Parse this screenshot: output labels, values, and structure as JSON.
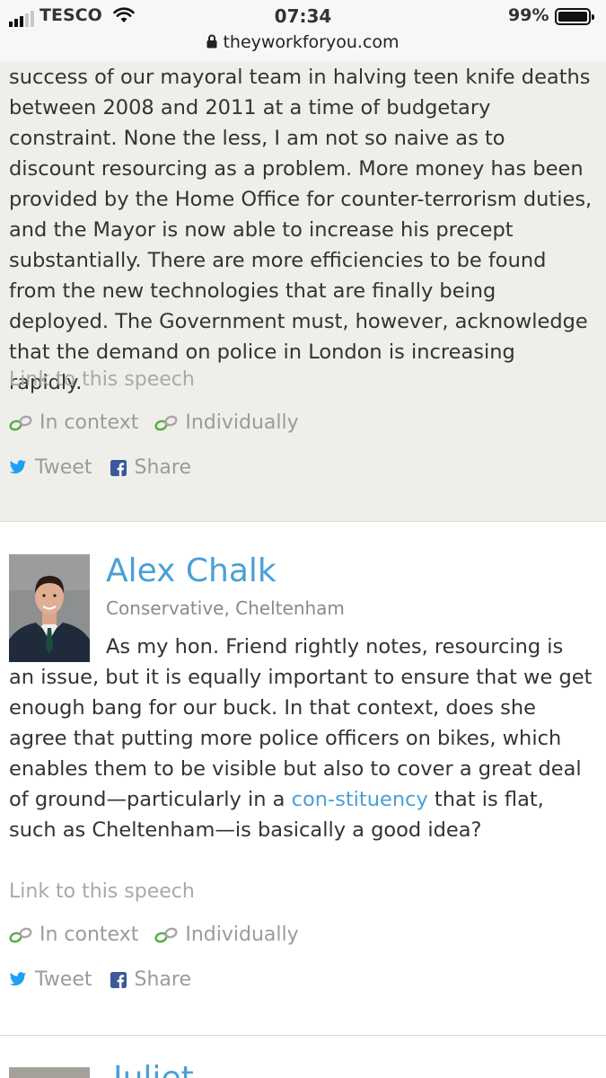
{
  "status_bar": {
    "carrier": "TESCO",
    "time": "07:34",
    "battery_percent": "99%",
    "signal_bars_filled": 3,
    "signal_bars_total": 5,
    "battery_level": 0.99,
    "url": "theyworkforyou.com"
  },
  "previous_speech": {
    "text": "success of our mayoral team in halving teen knife deaths between 2008 and 2011 at a time of budgetary constraint. None the less, I am not so naive as to discount resourcing as a problem. More money has been provided by the Home Office for counter-terrorism duties, and the Mayor is now able to increase his precept substantially. There are more efficiencies to be found from the new technologies that are finally being deployed. The Government must, however, acknowledge that the demand on police in London is increasing rapidly.",
    "link_label": "Link to this speech",
    "in_context_label": "In context",
    "individually_label": "Individually",
    "tweet_label": "Tweet",
    "share_label": "Share"
  },
  "main_speech": {
    "speaker_name": "Alex Chalk",
    "speaker_party": "Conservative, Cheltenham",
    "text_before_link": "As my hon. Friend rightly notes, resourcing is an issue, but it is equally important to ensure that we get enough bang for our buck. In that context, does she agree that putting more police officers on bikes, which enables them to be visible but also to cover a great deal of ground—particularly in a ",
    "linked_word_start": "con-",
    "linked_word_end": "stituency",
    "text_after_link": " that is flat, such as Cheltenham—is basically a good idea?",
    "link_label": "Link to this speech",
    "in_context_label": "In context",
    "individually_label": "Individually",
    "tweet_label": "Tweet",
    "share_label": "Share"
  },
  "next_speech": {
    "speaker_name_partial": "Juliet"
  },
  "colors": {
    "link_blue": "#4a9fd6",
    "twitter_blue": "#1da1f2",
    "facebook_blue": "#3b5998",
    "context_icon_green": "#5aaa46"
  }
}
